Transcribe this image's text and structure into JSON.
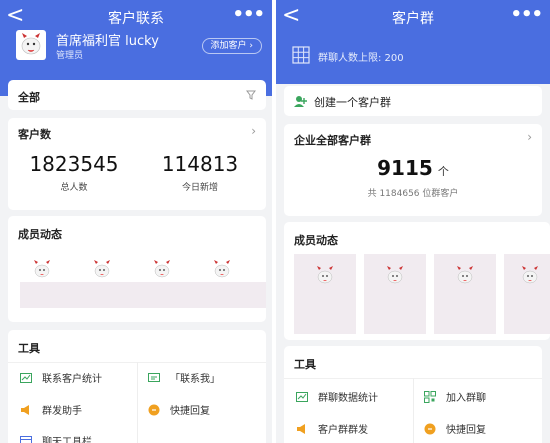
{
  "left": {
    "nav": {
      "back": "<",
      "title": "客户联系",
      "more": "•••"
    },
    "profile": {
      "name": "首席福利官 lucky",
      "role": "管理员",
      "add_button": "添加客户 ›"
    },
    "filter": {
      "label": "全部"
    },
    "customers": {
      "title": "客户数",
      "total_value": "1823545",
      "total_label": "总人数",
      "today_value": "114813",
      "today_label": "今日新增"
    },
    "members": {
      "title": "成员动态"
    },
    "tools": {
      "title": "工具",
      "items": [
        "联系客户统计",
        "「联系我」",
        "群发助手",
        "快捷回复",
        "聊天工具栏"
      ]
    }
  },
  "right": {
    "nav": {
      "back": "<",
      "title": "客户群",
      "more": "•••"
    },
    "limit_text": "群聊人数上限: 200",
    "create_group": "创建一个客户群",
    "enterprise": {
      "title": "企业全部客户群",
      "count": "9115",
      "unit": "个",
      "sub": "共 1184656 位群客户"
    },
    "members": {
      "title": "成员动态"
    },
    "tools": {
      "title": "工具",
      "items": [
        "群聊数据统计",
        "加入群聊",
        "客户群群发",
        "快捷回复"
      ]
    }
  },
  "colors": {
    "brand_blue": "#4a6ee0",
    "page_bg": "#f2f3f5",
    "green_icon": "#3aa55d",
    "orange_icon": "#f0a020"
  },
  "icons": [
    "back-chevron-icon",
    "more-icon",
    "filter-icon",
    "chevron-right-icon",
    "grid-icon",
    "add-group-icon",
    "chart-icon",
    "qr-icon",
    "megaphone-icon",
    "bubble-icon"
  ]
}
